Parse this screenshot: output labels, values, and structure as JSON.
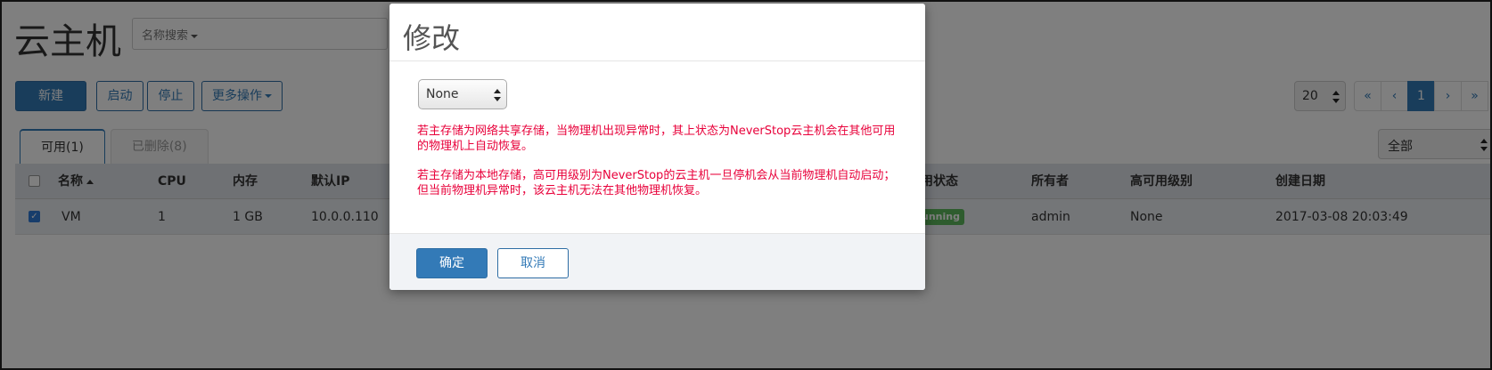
{
  "page": {
    "title": "云主机",
    "search_filter": "名称搜索"
  },
  "toolbar": {
    "new_label": "新建",
    "start_label": "启动",
    "stop_label": "停止",
    "more_label": "更多操作"
  },
  "pagination": {
    "page_size": "20",
    "first": "«",
    "prev": "‹",
    "current": "1",
    "next": "›",
    "last": "»"
  },
  "tabs": [
    {
      "label": "可用(1)",
      "active": true
    },
    {
      "label": "已删除(8)",
      "active": false
    }
  ],
  "filter": {
    "selected": "全部"
  },
  "table": {
    "headers": {
      "name": "名称",
      "cpu": "CPU",
      "memory": "内存",
      "ip": "默认IP",
      "status": "用状态",
      "owner": "所有者",
      "ha_level": "高可用级别",
      "created": "创建日期"
    },
    "rows": [
      {
        "checked": true,
        "name": "VM",
        "cpu": "1",
        "memory": "1 GB",
        "ip": "10.0.0.110",
        "status": "unning",
        "owner": "admin",
        "ha_level": "None",
        "created": "2017-03-08 20:03:49"
      }
    ]
  },
  "modal": {
    "title": "修改",
    "ha_select_value": "None",
    "warning_1": "若主存储为网络共享存储，当物理机出现异常时，其上状态为NeverStop云主机会在其他可用的物理机上自动恢复。",
    "warning_2": "若主存储为本地存储，高可用级别为NeverStop的云主机一旦停机会从当前物理机自动启动；但当前物理机异常时，该云主机无法在其他物理机恢复。",
    "ok_label": "确定",
    "cancel_label": "取消"
  },
  "colors": {
    "primary": "#337ab7",
    "warning_text": "#e8003a",
    "running_badge": "#5cb85c"
  }
}
